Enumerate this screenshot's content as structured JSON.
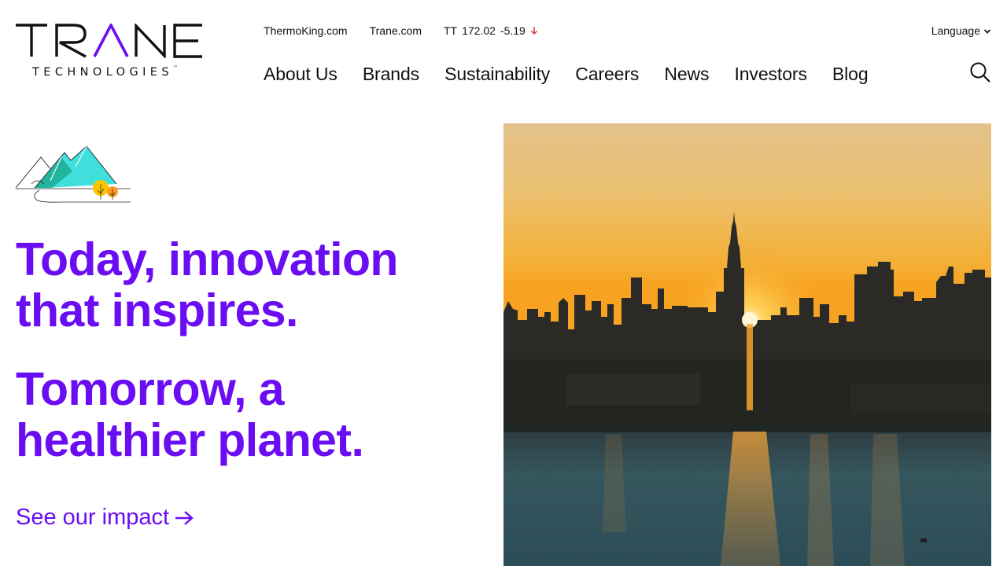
{
  "brand": {
    "logo_word": "TRANE",
    "logo_sub": "TECHNOLOGIES",
    "logo_tm": "™",
    "accent_color": "#6a0df2"
  },
  "utility": {
    "link1": "ThermoKing.com",
    "link2": "Trane.com",
    "stock_ticker": "TT",
    "stock_price": "172.02",
    "stock_change": "-5.19",
    "stock_direction_icon": "arrow-down-icon",
    "stock_down_color": "#d2232a",
    "language_label": "Language"
  },
  "nav": {
    "items": [
      "About Us",
      "Brands",
      "Sustainability",
      "Careers",
      "News",
      "Investors",
      "Blog"
    ]
  },
  "hero": {
    "headline1_line1": "Today, innovation",
    "headline1_line2": "that inspires.",
    "headline2_line1": "Tomorrow, a",
    "headline2_line2": "healthier planet.",
    "cta_label": "See our impact",
    "cta_arrow": "→"
  }
}
